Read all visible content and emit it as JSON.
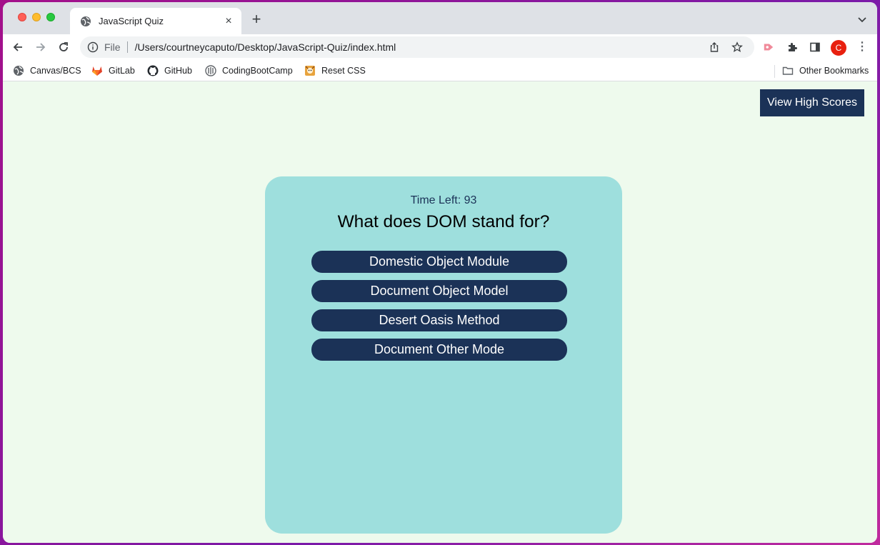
{
  "browser": {
    "tab_title": "JavaScript Quiz",
    "new_tab_label": "+",
    "tab_close_label": "×",
    "omnibox": {
      "scheme_label": "File",
      "url": "/Users/courtneycaputo/Desktop/JavaScript-Quiz/index.html"
    },
    "profile_initial": "C",
    "bookmarks": [
      {
        "label": "Canvas/BCS",
        "icon": "globe-icon"
      },
      {
        "label": "GitLab",
        "icon": "gitlab-icon"
      },
      {
        "label": "GitHub",
        "icon": "github-icon"
      },
      {
        "label": "CodingBootCamp",
        "icon": "bootcamp-icon"
      },
      {
        "label": "Reset CSS",
        "icon": "reset-css-icon"
      }
    ],
    "other_bookmarks_label": "Other Bookmarks",
    "colors": {
      "close": "#ff5f57",
      "minimize": "#febc2e",
      "maximize": "#28c840",
      "profile": "#e8200f"
    }
  },
  "page": {
    "high_scores_label": "View High Scores",
    "timer_text": "Time Left: 93",
    "question": "What does DOM stand for?",
    "answers": [
      "Domestic Object Module",
      "Document Object Model",
      "Desert Oasis Method",
      "Document Other Mode"
    ],
    "colors": {
      "background": "#eefaed",
      "card": "#9edfdd",
      "button": "#1b3257"
    }
  }
}
